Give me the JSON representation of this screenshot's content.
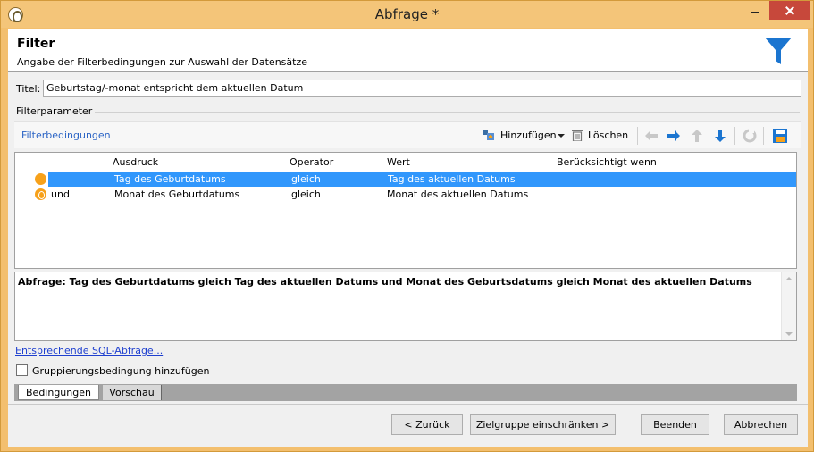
{
  "window": {
    "title": "Abfrage *"
  },
  "header": {
    "title": "Filter",
    "subtitle": "Angabe der Filterbedingungen zur Auswahl der Datensätze"
  },
  "form": {
    "title_label": "Titel:",
    "title_value": "Geburtstag/-monat entspricht dem aktuellen Datum",
    "group_label": "Filterparameter"
  },
  "toolbar": {
    "title": "Filterbedingungen",
    "add_label": "Hinzufügen",
    "delete_label": "Löschen"
  },
  "grid": {
    "columns": [
      "Ausdruck",
      "Operator",
      "Wert",
      "Berücksichtigt wenn"
    ],
    "rows": [
      {
        "connector": "",
        "expression": "Tag des Geburtdatums",
        "operator": "gleich",
        "value": "Tag des aktuellen Datums",
        "condition": ""
      },
      {
        "connector": "und",
        "expression": "Monat des Geburtdatums",
        "operator": "gleich",
        "value": "Monat des aktuellen Datums",
        "condition": ""
      }
    ]
  },
  "query": {
    "text": "Abfrage: Tag des Geburtdatums gleich Tag des aktuellen Datums und Monat des Geburtsdatums gleich Monat des aktuellen Datums"
  },
  "links": {
    "sql": "Entsprechende SQL-Abfrage..."
  },
  "options": {
    "grouping_label": "Gruppierungsbedingung hinzufügen",
    "grouping_checked": false
  },
  "tabs": {
    "conditions": "Bedingungen",
    "preview": "Vorschau"
  },
  "buttons": {
    "back": "< Zurück",
    "next": "Zielgruppe einschränken >",
    "finish": "Beenden",
    "cancel": "Abbrechen"
  },
  "colors": {
    "accent": "#3197fc",
    "titlebar": "#f4c579",
    "link": "#1e3fcf",
    "icon_blue": "#1b75d0"
  }
}
